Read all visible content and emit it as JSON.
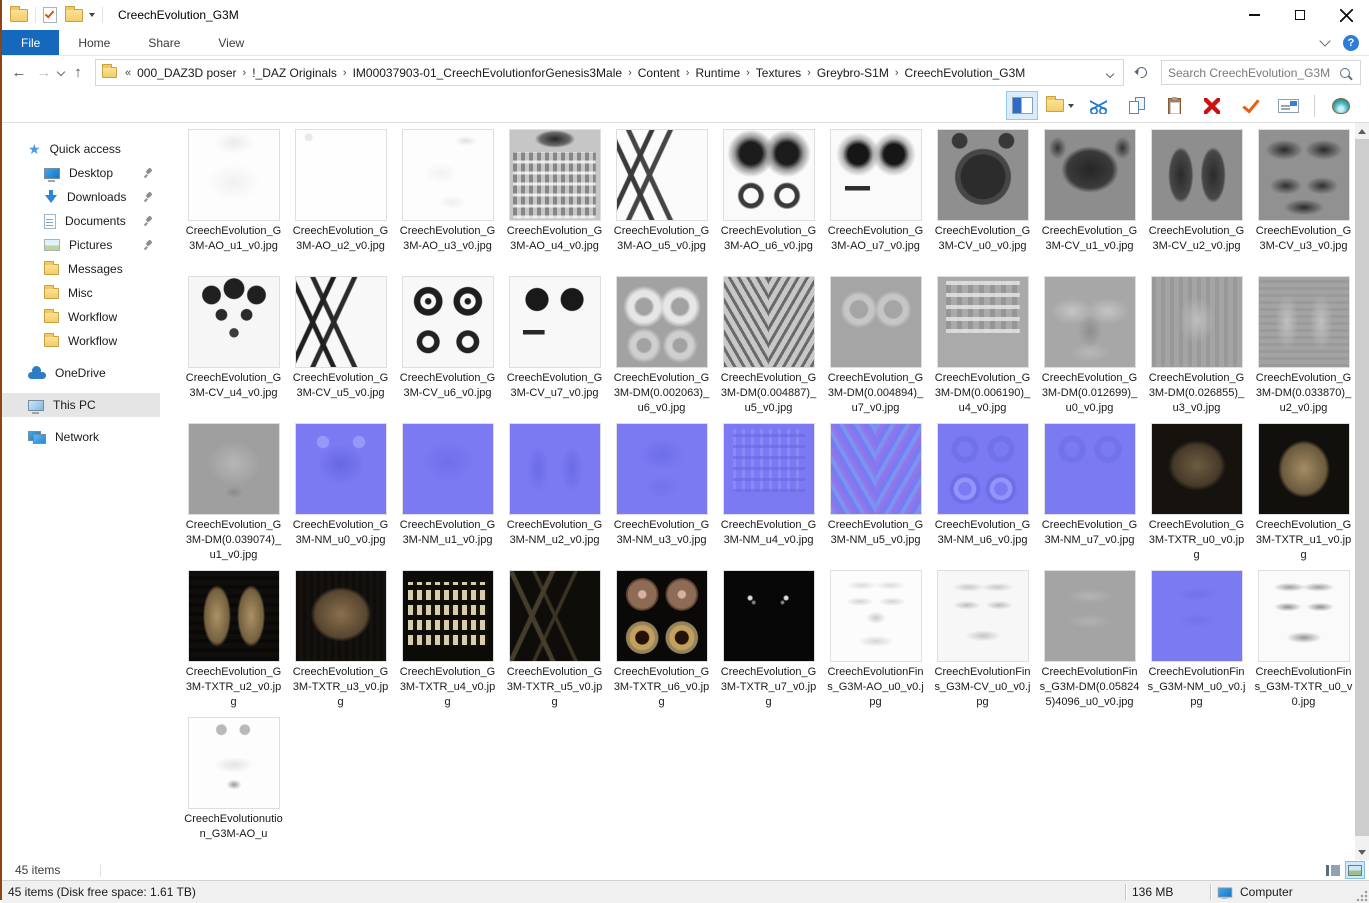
{
  "window": {
    "title": "CreechEvolution_G3M"
  },
  "ribbon": {
    "tabs": [
      "File",
      "Home",
      "Share",
      "View"
    ],
    "active_tab": "File"
  },
  "nav": {
    "breadcrumb_overflow": "«",
    "separator": "›",
    "segments": [
      "000_DAZ3D poser",
      "!_DAZ Originals",
      "IM00037903-01_CreechEvolutionforGenesis3Male",
      "Content",
      "Runtime",
      "Textures",
      "Greybro-S1M",
      "CreechEvolution_G3M"
    ]
  },
  "search": {
    "placeholder": "Search CreechEvolution_G3M"
  },
  "toolbar": {
    "buttons": [
      {
        "name": "preview-pane",
        "icon": "preview-pane-icon",
        "active": true
      },
      {
        "name": "new-folder",
        "icon": "new-folder-icon",
        "dropdown": true
      },
      {
        "name": "cut",
        "icon": "cut-icon"
      },
      {
        "name": "copy",
        "icon": "copy-icon"
      },
      {
        "name": "paste",
        "icon": "paste-icon"
      },
      {
        "name": "delete",
        "icon": "delete-icon"
      },
      {
        "name": "confirm",
        "icon": "checkmark-icon"
      },
      {
        "name": "rename",
        "icon": "rename-icon"
      },
      {
        "name": "shell",
        "icon": "shell-icon",
        "separated": true
      }
    ]
  },
  "sidebar": {
    "items": [
      {
        "label": "Quick access",
        "icon": "quick-access-icon",
        "level": 0
      },
      {
        "label": "Desktop",
        "icon": "desktop-icon",
        "level": 1,
        "pinned": true
      },
      {
        "label": "Downloads",
        "icon": "downloads-icon",
        "level": 1,
        "pinned": true
      },
      {
        "label": "Documents",
        "icon": "documents-icon",
        "level": 1,
        "pinned": true
      },
      {
        "label": "Pictures",
        "icon": "pictures-icon",
        "level": 1,
        "pinned": true
      },
      {
        "label": "Messages",
        "icon": "folder-icon",
        "level": 1
      },
      {
        "label": "Misc",
        "icon": "folder-icon",
        "level": 1
      },
      {
        "label": "Workflow",
        "icon": "folder-icon",
        "level": 1
      },
      {
        "label": "Workflow",
        "icon": "folder-icon",
        "level": 1
      },
      {
        "label": "OneDrive",
        "icon": "onedrive-icon",
        "level": 0,
        "gap_before": true
      },
      {
        "label": "This PC",
        "icon": "this-pc-icon",
        "level": 0,
        "gap_before": true,
        "selected": true
      },
      {
        "label": "Network",
        "icon": "network-icon",
        "level": 0,
        "gap_before": true
      }
    ]
  },
  "files": [
    {
      "name": "CreechEvolution_G3M-AO_u1_v0.jpg",
      "thumb": "ao-faint"
    },
    {
      "name": "CreechEvolution_G3M-AO_u2_v0.jpg",
      "thumb": "ao-blank"
    },
    {
      "name": "CreechEvolution_G3M-AO_u3_v0.jpg",
      "thumb": "ao-marks"
    },
    {
      "name": "CreechEvolution_G3M-AO_u4_v0.jpg",
      "thumb": "ao-grid"
    },
    {
      "name": "CreechEvolution_G3M-AO_u5_v0.jpg",
      "thumb": "ao-claws"
    },
    {
      "name": "CreechEvolution_G3M-AO_u6_v0.jpg",
      "thumb": "ao-eye-rings"
    },
    {
      "name": "CreechEvolution_G3M-AO_u7_v0.jpg",
      "thumb": "ao-eyes"
    },
    {
      "name": "CreechEvolution_G3M-CV_u0_v0.jpg",
      "thumb": "cv-round"
    },
    {
      "name": "CreechEvolution_G3M-CV_u1_v0.jpg",
      "thumb": "cv-mask"
    },
    {
      "name": "CreechEvolution_G3M-CV_u2_v0.jpg",
      "thumb": "cv-legs"
    },
    {
      "name": "CreechEvolution_G3M-CV_u3_v0.jpg",
      "thumb": "cv-scatter"
    },
    {
      "name": "CreechEvolution_G3M-CV_u4_v0.jpg",
      "thumb": "cv-blobs"
    },
    {
      "name": "CreechEvolution_G3M-CV_u5_v0.jpg",
      "thumb": "cv-claws"
    },
    {
      "name": "CreechEvolution_G3M-CV_u6_v0.jpg",
      "thumb": "cv-rings"
    },
    {
      "name": "CreechEvolution_G3M-CV_u7_v0.jpg",
      "thumb": "cv-dots"
    },
    {
      "name": "CreechEvolution_G3M-DM(0.002063)_u6_v0.jpg",
      "thumb": "dm-rings-bright"
    },
    {
      "name": "CreechEvolution_G3M-DM(0.004887)_u5_v0.jpg",
      "thumb": "dm-zebra"
    },
    {
      "name": "CreechEvolution_G3M-DM(0.004894)_u7_v0.jpg",
      "thumb": "dm-rings-soft"
    },
    {
      "name": "CreechEvolution_G3M-DM(0.006190)_u4_v0.jpg",
      "thumb": "dm-blocks"
    },
    {
      "name": "CreechEvolution_G3M-DM(0.012699)_u0_v0.jpg",
      "thumb": "dm-wings"
    },
    {
      "name": "CreechEvolution_G3M-DM(0.026855)_u3_v0.jpg",
      "thumb": "dm-body"
    },
    {
      "name": "CreechEvolution_G3M-DM(0.033870)_u2_v0.jpg",
      "thumb": "dm-legs"
    },
    {
      "name": "CreechEvolution_G3M-DM(0.039074)_u1_v0.jpg",
      "thumb": "dm-mask"
    },
    {
      "name": "CreechEvolution_G3M-NM_u0_v0.jpg",
      "thumb": "nm-face"
    },
    {
      "name": "CreechEvolution_G3M-NM_u1_v0.jpg",
      "thumb": "nm-soft"
    },
    {
      "name": "CreechEvolution_G3M-NM_u2_v0.jpg",
      "thumb": "nm-columns"
    },
    {
      "name": "CreechEvolution_G3M-NM_u3_v0.jpg",
      "thumb": "nm-torso"
    },
    {
      "name": "CreechEvolution_G3M-NM_u4_v0.jpg",
      "thumb": "nm-dots"
    },
    {
      "name": "CreechEvolution_G3M-NM_u5_v0.jpg",
      "thumb": "nm-zebra"
    },
    {
      "name": "CreechEvolution_G3M-NM_u6_v0.jpg",
      "thumb": "nm-rings4"
    },
    {
      "name": "CreechEvolution_G3M-NM_u7_v0.jpg",
      "thumb": "nm-rings2"
    },
    {
      "name": "CreechEvolution_G3M-TXTR_u0_v0.jpg",
      "thumb": "txtr-face"
    },
    {
      "name": "CreechEvolution_G3M-TXTR_u1_v0.jpg",
      "thumb": "txtr-body"
    },
    {
      "name": "CreechEvolution_G3M-TXTR_u2_v0.jpg",
      "thumb": "txtr-legs"
    },
    {
      "name": "CreechEvolution_G3M-TXTR_u3_v0.jpg",
      "thumb": "txtr-torso"
    },
    {
      "name": "CreechEvolution_G3M-TXTR_u4_v0.jpg",
      "thumb": "txtr-teeth"
    },
    {
      "name": "CreechEvolution_G3M-TXTR_u5_v0.jpg",
      "thumb": "txtr-claws"
    },
    {
      "name": "CreechEvolution_G3M-TXTR_u6_v0.jpg",
      "thumb": "txtr-eyes"
    },
    {
      "name": "CreechEvolution_G3M-TXTR_u7_v0.jpg",
      "thumb": "txtr-dark"
    },
    {
      "name": "CreechEvolutionFins_G3M-AO_u0_v0.jpg",
      "thumb": "fins-ao"
    },
    {
      "name": "CreechEvolutionFins_G3M-CV_u0_v0.jpg",
      "thumb": "fins-cv"
    },
    {
      "name": "CreechEvolutionFins_G3M-DM(0.058245)4096_u0_v0.jpg",
      "thumb": "fins-dm"
    },
    {
      "name": "CreechEvolutionFins_G3M-NM_u0_v0.jpg",
      "thumb": "fins-nm"
    },
    {
      "name": "CreechEvolutionFins_G3M-TXTR_u0_v0.jpg",
      "thumb": "fins-txtr"
    },
    {
      "name": "CreechEvolutionution_G3M-AO_u",
      "thumb": "ao-face-faint"
    }
  ],
  "statusbar": {
    "item_count": "45 items"
  },
  "bottombar": {
    "summary": "45 items (Disk free space: 1.61 TB)",
    "size": "136 MB",
    "computer_label": "Computer"
  }
}
